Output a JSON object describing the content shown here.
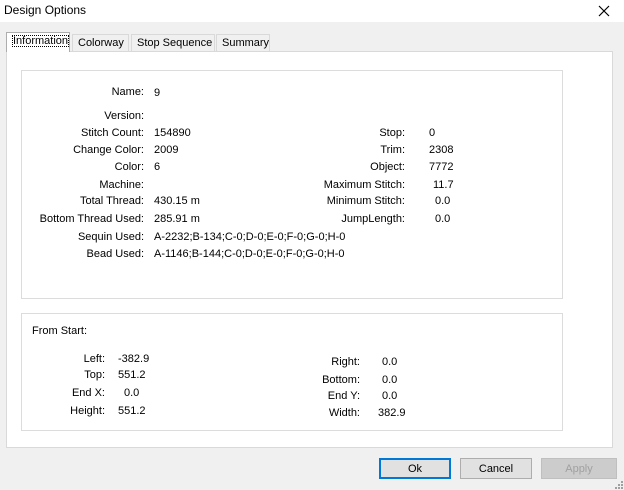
{
  "window": {
    "title": "Design Options"
  },
  "tabs": [
    "Information",
    "Colorway",
    "Stop Sequence",
    "Summary"
  ],
  "info": {
    "name": {
      "label": "Name:",
      "value": "9"
    },
    "version": {
      "label": "Version:",
      "value": ""
    },
    "stitch_count": {
      "label": "Stitch Count:",
      "value": "154890"
    },
    "change_color": {
      "label": "Change Color:",
      "value": "2009"
    },
    "color": {
      "label": "Color:",
      "value": "6"
    },
    "machine": {
      "label": "Machine:",
      "value": ""
    },
    "total_thread": {
      "label": "Total Thread:",
      "value": "430.15 m"
    },
    "bottom_thread": {
      "label": "Bottom Thread Used:",
      "value": "285.91 m"
    },
    "sequin": {
      "label": "Sequin Used:",
      "value": "A-2232;B-134;C-0;D-0;E-0;F-0;G-0;H-0"
    },
    "bead": {
      "label": "Bead Used:",
      "value": "A-1146;B-144;C-0;D-0;E-0;F-0;G-0;H-0"
    },
    "stop": {
      "label": "Stop:",
      "value": "0"
    },
    "trim": {
      "label": "Trim:",
      "value": "2308"
    },
    "object": {
      "label": "Object:",
      "value": "7772"
    },
    "max_stitch": {
      "label": "Maximum Stitch:",
      "value": "11.7"
    },
    "min_stitch": {
      "label": "Minimum Stitch:",
      "value": "0.0"
    },
    "jump_length": {
      "label": "JumpLength:",
      "value": "0.0"
    }
  },
  "from_start": {
    "heading": "From Start:",
    "left": {
      "label": "Left:",
      "value": "-382.9"
    },
    "top": {
      "label": "Top:",
      "value": "551.2"
    },
    "end_x": {
      "label": "End X:",
      "value": "0.0"
    },
    "height": {
      "label": "Height:",
      "value": "551.2"
    },
    "right": {
      "label": "Right:",
      "value": "0.0"
    },
    "bottom": {
      "label": "Bottom:",
      "value": "0.0"
    },
    "end_y": {
      "label": "End Y:",
      "value": "0.0"
    },
    "width": {
      "label": "Width:",
      "value": "382.9"
    }
  },
  "buttons": {
    "ok": "Ok",
    "cancel": "Cancel",
    "apply": "Apply"
  },
  "icons": {
    "close": "close-icon",
    "grip": "resize-grip-icon"
  },
  "colors": {
    "default_button_border": "#0078d7",
    "dialog_bg": "#f0f0f0"
  }
}
